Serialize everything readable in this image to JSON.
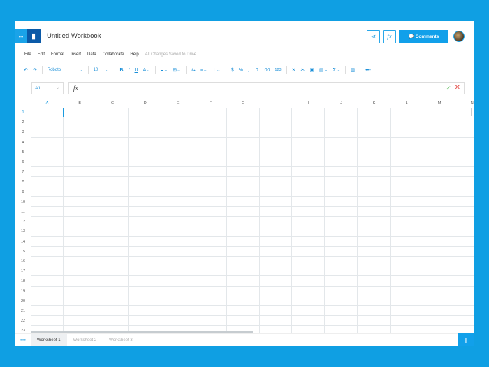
{
  "app": {
    "title": "Untitled Workbook",
    "comments_label": "Comments",
    "fx_label": "fx"
  },
  "menu": {
    "items": [
      "File",
      "Edit",
      "Format",
      "Insert",
      "Data",
      "Collaborate",
      "Help"
    ],
    "status": "All Changes Saved to Drive"
  },
  "toolbar": {
    "font": "Roboto",
    "size": "10",
    "number_format": "123"
  },
  "formula": {
    "cell_ref": "A1",
    "value": ""
  },
  "grid": {
    "columns": [
      "A",
      "B",
      "C",
      "D",
      "E",
      "F",
      "G",
      "H",
      "I",
      "J",
      "K",
      "L",
      "M",
      "N"
    ],
    "rows": [
      "1",
      "2",
      "3",
      "4",
      "5",
      "6",
      "7",
      "8",
      "9",
      "10",
      "11",
      "12",
      "13",
      "14",
      "15",
      "16",
      "17",
      "18",
      "19",
      "20",
      "21",
      "22",
      "23"
    ],
    "selected": "A1"
  },
  "sheets": [
    "Worksheet 1",
    "Worksheet 2",
    "Worksheet 3"
  ],
  "colors": {
    "accent": "#11a0ea",
    "background": "#0f9fe3"
  }
}
